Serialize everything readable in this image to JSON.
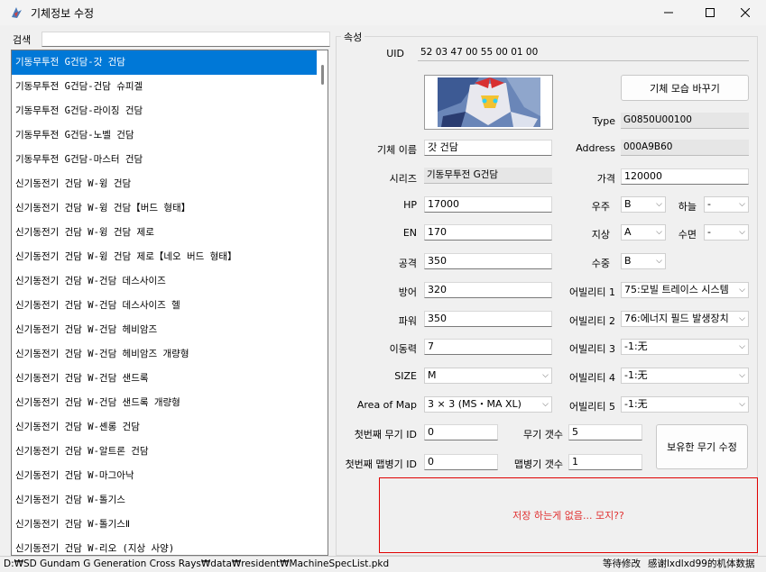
{
  "window": {
    "title": "기체정보 수정"
  },
  "search": {
    "label": "검색",
    "value": ""
  },
  "list": [
    "기동무투전 G건담-갓 건담",
    "기동무투전 G건담-건담 슈피겔",
    "기동무투전 G건담-라이징 건담",
    "기동무투전 G건담-노벨 건담",
    "기동무투전 G건담-마스터 건담",
    "신기동전기 건담 W-윙 건담",
    "신기동전기 건담 W-윙 건담【버드 형태】",
    "신기동전기 건담 W-윙 건담 제로",
    "신기동전기 건담 W-윙 건담 제로【네오 버드 형태】",
    "신기동전기 건담 W-건담 데스사이즈",
    "신기동전기 건담 W-건담 데스사이즈 헬",
    "신기동전기 건담 W-건담 헤비암즈",
    "신기동전기 건담 W-건담 헤비암즈 개량형",
    "신기동전기 건담 W-건담 샌드록",
    "신기동전기 건담 W-건담 샌드록 개량형",
    "신기동전기 건담 W-셴롱 건담",
    "신기동전기 건담 W-알트론 건담",
    "신기동전기 건담 W-마그아낙",
    "신기동전기 건담 W-톨기스",
    "신기동전기 건담 W-톨기스Ⅱ",
    "신기동전기 건담 W-리오 (지상 사양)"
  ],
  "group": {
    "title": "속성"
  },
  "fields": {
    "uid_label": "UID",
    "uid": "52 03 47 00 55 00 01 00",
    "change_appearance": "기체 모습 바꾸기",
    "type_label": "Type",
    "type": "G0850U00100",
    "name_label": "기체 이름",
    "name": "갓 건담",
    "address_label": "Address",
    "address": "000A9B60",
    "series_label": "시리즈",
    "series": "기동무투전 G건담",
    "price_label": "가격",
    "price": "120000",
    "hp_label": "HP",
    "hp": "17000",
    "space_label": "우주",
    "space": "B",
    "sky_label": "하늘",
    "sky": "-",
    "en_label": "EN",
    "en": "170",
    "ground_label": "지상",
    "ground": "A",
    "surface_label": "수면",
    "surface": "-",
    "attack_label": "공격",
    "attack": "350",
    "underwater_label": "수중",
    "underwater": "B",
    "defense_label": "방어",
    "defense": "320",
    "ability1_label": "어빌리티 1",
    "ability1": "75:모빌 트레이스 시스템",
    "power_label": "파워",
    "power": "350",
    "ability2_label": "어빌리티 2",
    "ability2": "76:에너지 필드 발생장치",
    "move_label": "이동력",
    "move": "7",
    "ability3_label": "어빌리티 3",
    "ability3": "-1:无",
    "size_label": "SIZE",
    "size": "M",
    "ability4_label": "어빌리티 4",
    "ability4": "-1:无",
    "map_label": "Area of Map",
    "map": "3 × 3 (MS・MA XL)",
    "ability5_label": "어빌리티 5",
    "ability5": "-1:无",
    "weapon_id_label": "첫번째 무기 ID",
    "weapon_id": "0",
    "weapon_count_label": "무기 갯수",
    "weapon_count": "5",
    "map_weapon_id_label": "첫번째 맵병기 ID",
    "map_weapon_id": "0",
    "map_weapon_count_label": "맵병기 갯수",
    "map_weapon_count": "1",
    "edit_weapons": "보유한 무기 수정"
  },
  "notice": "저장 하는게 없음... 모지??",
  "status": {
    "path": "D:₩SD Gundam G Generation Cross Rays₩data₩resident₩MachineSpecList.pkd",
    "state": "等待修改",
    "credit": "感谢lxdlxd99的机体数据"
  },
  "colors": {
    "selection": "#0078d7",
    "notice_border": "#e00000",
    "notice_text": "#e03030"
  }
}
